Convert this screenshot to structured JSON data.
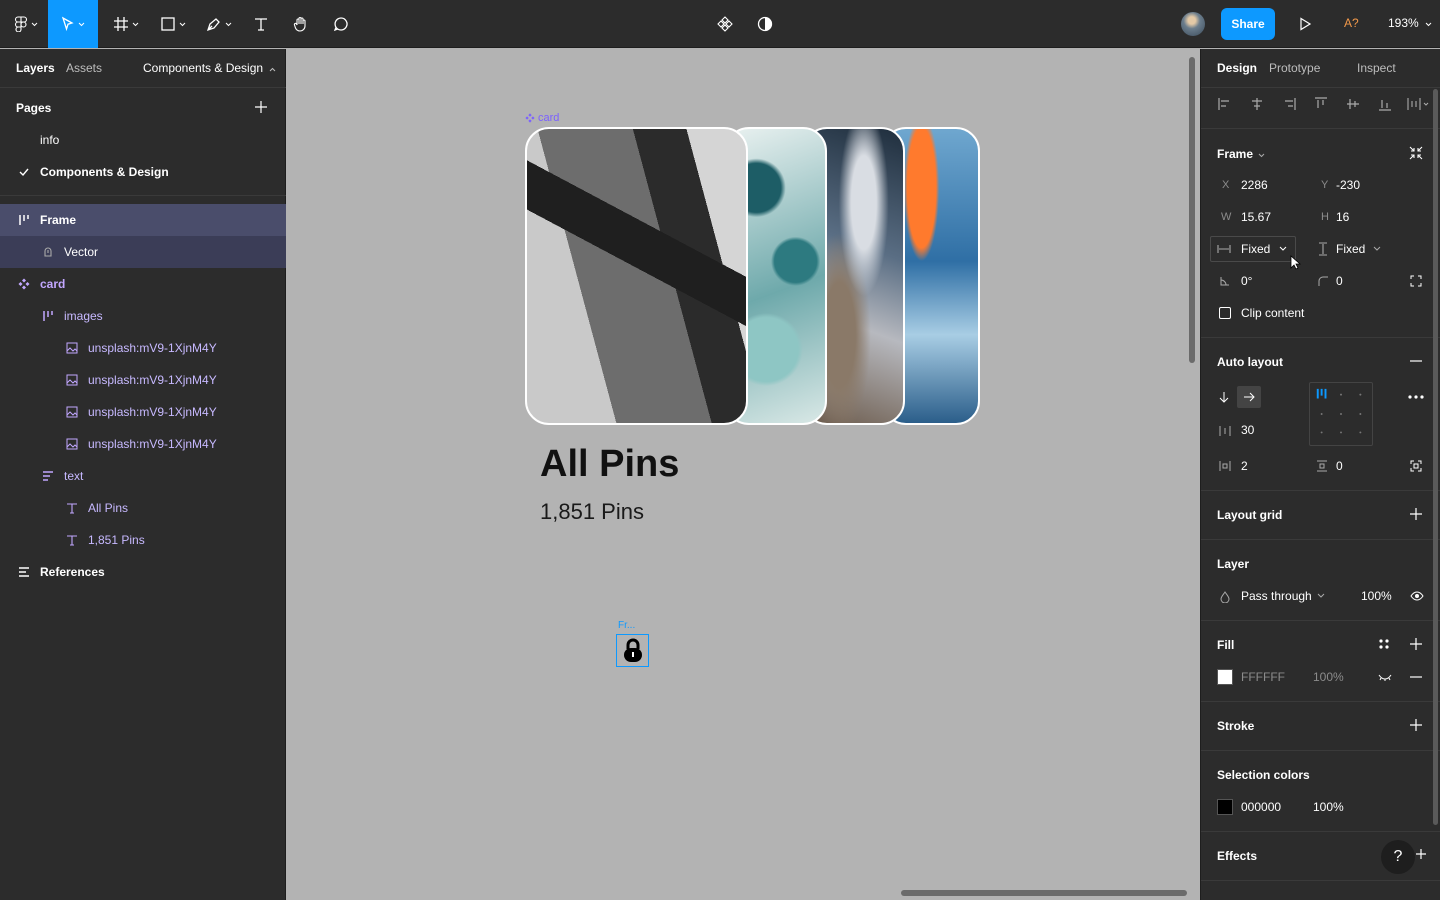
{
  "toolbar": {
    "share_label": "Share",
    "zoom": "193%",
    "multiplayer_label": "A?"
  },
  "left_panel": {
    "tabs": [
      "Layers",
      "Assets"
    ],
    "page_dropdown": "Components & Design",
    "pages_title": "Pages",
    "pages": [
      "info",
      "Components & Design"
    ],
    "layers": [
      {
        "name": "Frame"
      },
      {
        "name": "Vector"
      },
      {
        "name": "card"
      },
      {
        "name": "images"
      },
      {
        "name": "unsplash:mV9-1XjnM4Y"
      },
      {
        "name": "unsplash:mV9-1XjnM4Y"
      },
      {
        "name": "unsplash:mV9-1XjnM4Y"
      },
      {
        "name": "unsplash:mV9-1XjnM4Y"
      },
      {
        "name": "text"
      },
      {
        "name": "All Pins"
      },
      {
        "name": "1,851 Pins"
      },
      {
        "name": "References"
      }
    ]
  },
  "canvas": {
    "card_label": "card",
    "title": "All Pins",
    "count": "1,851 Pins",
    "frame_label": "Fr..."
  },
  "right_panel": {
    "tabs": [
      "Design",
      "Prototype",
      "Inspect"
    ],
    "frame": {
      "title": "Frame",
      "x_label": "X",
      "x": "2286",
      "y_label": "Y",
      "y": "-230",
      "w_label": "W",
      "w": "15.67",
      "h_label": "H",
      "h": "16",
      "horizontal_resizing": "Fixed",
      "vertical_resizing": "Fixed",
      "rotation": "0°",
      "radius": "0",
      "clip_content": "Clip content"
    },
    "auto_layout": {
      "title": "Auto layout",
      "spacing": "30",
      "padding_h": "2",
      "padding_v": "0"
    },
    "layout_grid": {
      "title": "Layout grid"
    },
    "layer": {
      "title": "Layer",
      "blend": "Pass through",
      "opacity": "100%"
    },
    "fill": {
      "title": "Fill",
      "hex": "FFFFFF",
      "opacity": "100%",
      "color": "#FFFFFF"
    },
    "stroke": {
      "title": "Stroke"
    },
    "selection_colors": {
      "title": "Selection colors",
      "hex": "000000",
      "opacity": "100%",
      "color": "#000000"
    },
    "effects": {
      "title": "Effects"
    }
  },
  "help_label": "?",
  "colors": {
    "accent": "#0d99ff",
    "component": "#7b61ff",
    "panel": "#2c2c2c",
    "canvas": "#b3b3b3"
  }
}
